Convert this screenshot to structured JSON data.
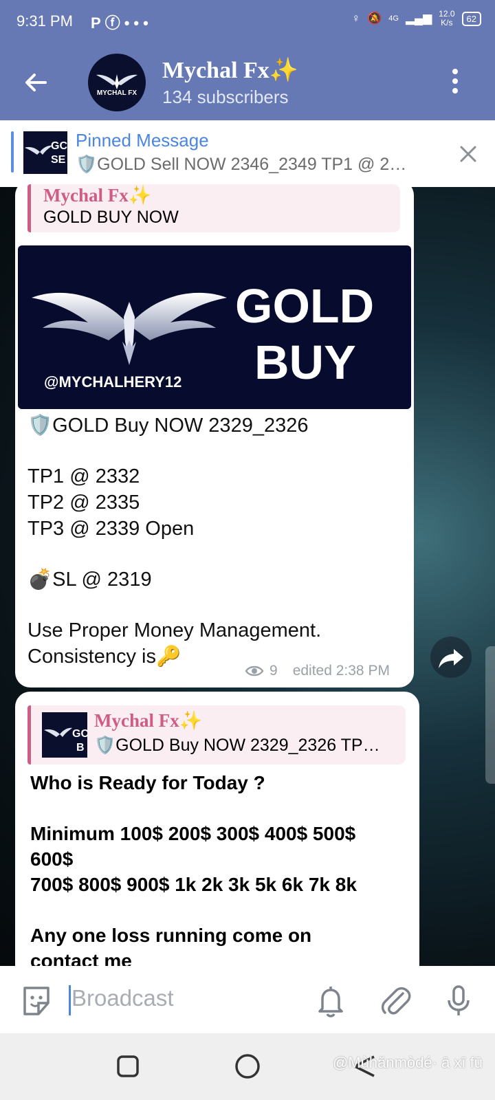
{
  "status_bar": {
    "time": "9:31 PM",
    "notification_icons": [
      "P",
      "facebook-icon",
      "•••"
    ],
    "network": "4G",
    "speed_value": "12.0",
    "speed_unit": "K/s",
    "battery": "62"
  },
  "header": {
    "channel_name": "Mychal Fx✨",
    "subscribers": "134 subscribers",
    "avatar_text": "MYCHAL FX"
  },
  "pinned": {
    "title": "Pinned Message",
    "text": "🛡️GOLD Sell NOW 2346_2349  TP1 @ 2…",
    "thumb_text": "GC\nSE"
  },
  "message1": {
    "reply_name": "Mychal Fx✨",
    "reply_text": "GOLD BUY NOW",
    "image": {
      "handle": "@MYCHALHERY12",
      "line1": "GOLD",
      "line2": "BUY"
    },
    "lines": [
      "🛡️GOLD Buy NOW 2329_2326",
      "TP1 @ 2332",
      "TP2 @ 2335",
      "TP3 @ 2339 Open",
      "💣SL @ 2319",
      "Use Proper Money Management.",
      "Consistency is🔑"
    ],
    "views": "9",
    "edited": "edited 2:38 PM"
  },
  "message2": {
    "reply_name": "Mychal Fx✨",
    "reply_text": "🛡️GOLD Buy NOW 2329_2326  TP…",
    "lines": [
      "Who is Ready for Today ?",
      "Minimum 100$ 200$ 300$ 400$ 500$",
      "600$",
      "700$ 800$ 900$ 1k 2k 3k 5k 6k 7k 8k",
      "Any one loss running come on",
      "contact me"
    ]
  },
  "input": {
    "placeholder": "Broadcast"
  },
  "watermark": "@Mùhǎnmòdé· ā xī fū",
  "colors": {
    "header": "#6779b5",
    "accent": "#4a86e0",
    "reply_name": "#d05c84"
  }
}
